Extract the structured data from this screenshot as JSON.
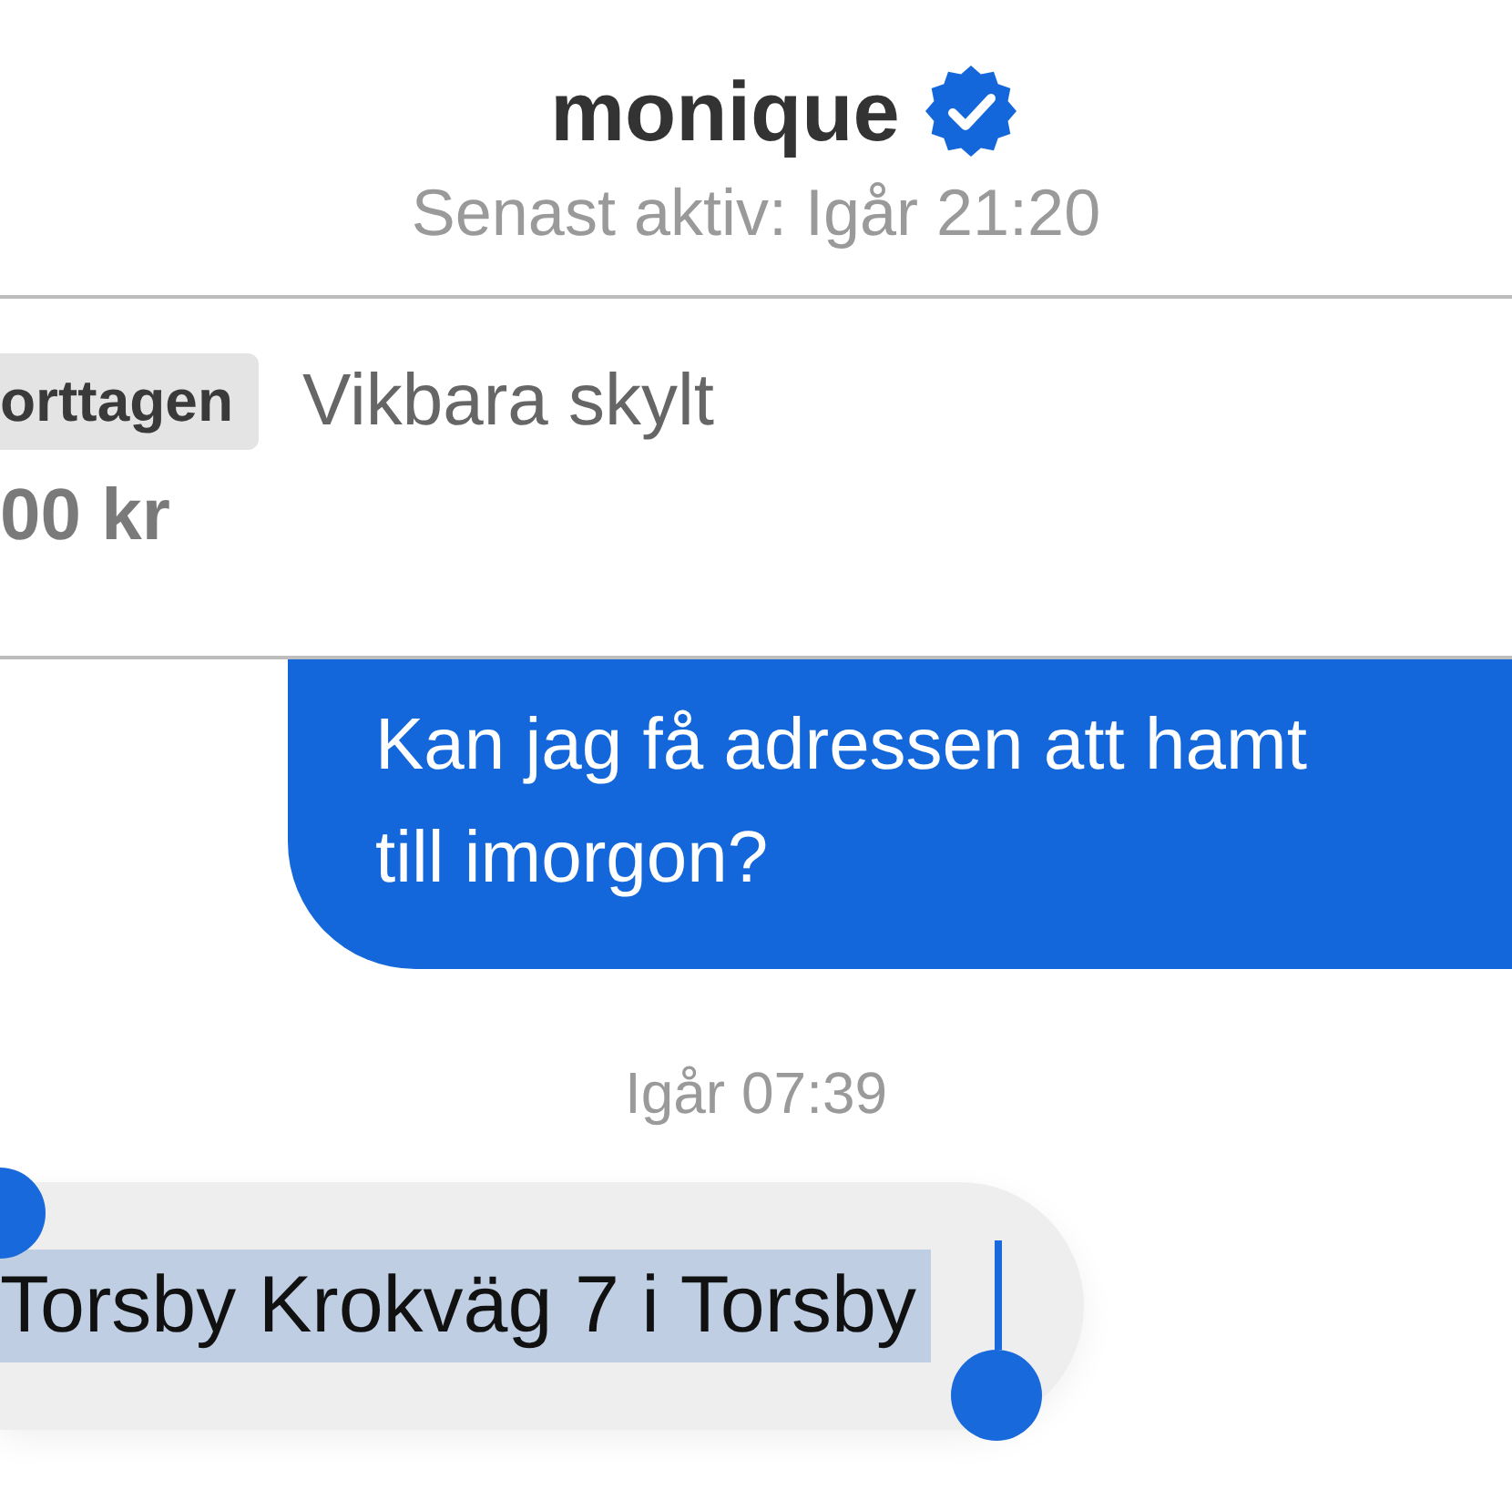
{
  "header": {
    "name": "monique",
    "verified": true,
    "status": "Senast aktiv: Igår 21:20"
  },
  "listing": {
    "tag": "orttagen",
    "title": "Vikbara skylt",
    "price": "00 kr"
  },
  "messages": [
    {
      "kind": "sent",
      "text": "Kan jag få adressen att hamt\ntill imorgon?",
      "selected": false
    },
    {
      "kind": "timestamp",
      "text": "Igår 07:39"
    },
    {
      "kind": "received",
      "text": "Torsby Krokväg 7 i Torsby",
      "selected": true
    }
  ]
}
